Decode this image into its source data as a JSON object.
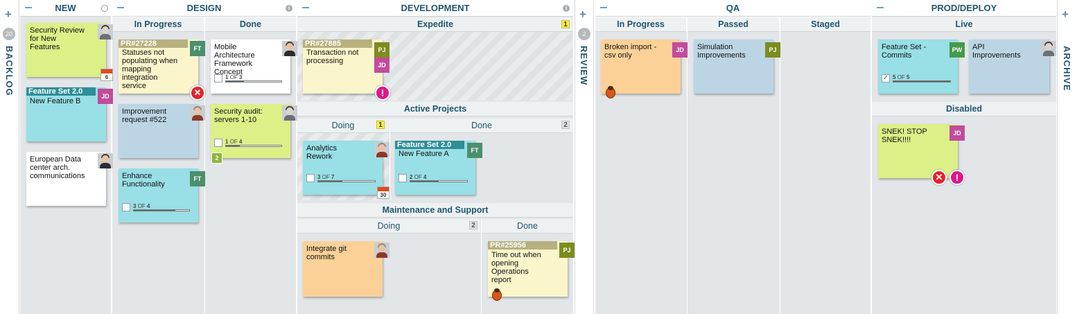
{
  "side": {
    "backlog_label": "BACKLOG",
    "backlog_count": "20",
    "review_label": "REVIEW",
    "review_count": "2",
    "archive_label": "ARCHIVE"
  },
  "columns": {
    "new": "NEW",
    "design": "DESIGN",
    "development": "DEVELOPMENT",
    "qa": "QA",
    "prod": "PROD/DEPLOY"
  },
  "subcolumns": {
    "design_in_progress": "In Progress",
    "design_done": "Done",
    "expedite": "Expedite",
    "expedite_wip": "1",
    "active_projects": "Active Projects",
    "ap_doing": "Doing",
    "ap_doing_wip": "1",
    "ap_done": "Done",
    "ap_done_wip": "2",
    "maint": "Maintenance and Support",
    "ms_doing": "Doing",
    "ms_doing_wip": "2",
    "ms_done": "Done",
    "qa_in_progress": "In Progress",
    "qa_passed": "Passed",
    "qa_staged": "Staged",
    "live": "Live",
    "disabled": "Disabled"
  },
  "cards": {
    "security_review": {
      "title": "Security Review for New Features",
      "due": "6"
    },
    "feature_set_b": {
      "band": "Feature Set 2.0",
      "title": "New Feature B",
      "avatar": "JD"
    },
    "european_dc": {
      "title": "European Data center arch. communications"
    },
    "pr27228": {
      "band": "PR#27228",
      "title": "Statuses not populating when mapping integration service",
      "avatar": "FT"
    },
    "improvement522": {
      "title": "Improvement request #522"
    },
    "enhance": {
      "title": "Enhance Functionality",
      "avatar": "FT",
      "done": "3",
      "of": "OF",
      "total": "4",
      "fraction": 0.75
    },
    "mobile_arch": {
      "title": "Mobile Architecture Framework Concept",
      "done": "1",
      "of": "OF",
      "total": "3",
      "fraction": 0.33
    },
    "security_audit": {
      "title": "Security audit: servers 1-10",
      "done": "1",
      "of": "OF",
      "total": "4",
      "fraction": 0.25,
      "count": "2"
    },
    "pr27885": {
      "band": "PR#27885",
      "title": "Transaction not processing",
      "avatar1": "PJ",
      "avatar2": "JD"
    },
    "analytics": {
      "title": "Analytics Rework",
      "done": "3",
      "of": "OF",
      "total": "7",
      "fraction": 0.43,
      "due": "30"
    },
    "feature_set_a": {
      "band": "Feature Set 2.0",
      "title": "New Feature A",
      "avatar": "FT",
      "done": "2",
      "of": "OF",
      "total": "4",
      "fraction": 0.5
    },
    "integrate_git": {
      "title": "Integrate git commits"
    },
    "pr25956": {
      "band": "PR#25956",
      "title": "Time out when opening Operations report",
      "avatar": "PJ"
    },
    "broken_import": {
      "title": "Broken import - csv only",
      "avatar": "JD"
    },
    "simulation": {
      "title": "Simulation Improvements",
      "avatar": "PJ"
    },
    "fs_commits": {
      "title": "Feature Set - Commits",
      "avatar": "PW",
      "done": "5",
      "of": "OF",
      "total": "5",
      "fraction": 1.0
    },
    "api_improvements": {
      "title": "API Improvements"
    },
    "snek": {
      "title": "SNEK! STOP SNEK!!!!",
      "avatar": "JD"
    }
  },
  "colors": {
    "header_text": "#1f5570",
    "lane_bg": "#e3e6e8",
    "card_lime": "#dbf087",
    "card_cyan": "#98dfe6",
    "card_blue": "#bcd5e4",
    "card_orange": "#fcd197",
    "card_cream": "#fbf5cb",
    "blocked_red": "#e5222b",
    "priority_pink": "#e0158a"
  },
  "icons": {
    "blocked": "x-circle-icon",
    "priority": "exclamation-icon",
    "defect": "bug-icon",
    "due_date": "calendar-icon",
    "info": "info-icon",
    "checklist": "checkbox-icon"
  },
  "glyphs": {
    "plus": "+",
    "info": "i",
    "x": "✕",
    "exclaim": "!",
    "check": "✓"
  }
}
